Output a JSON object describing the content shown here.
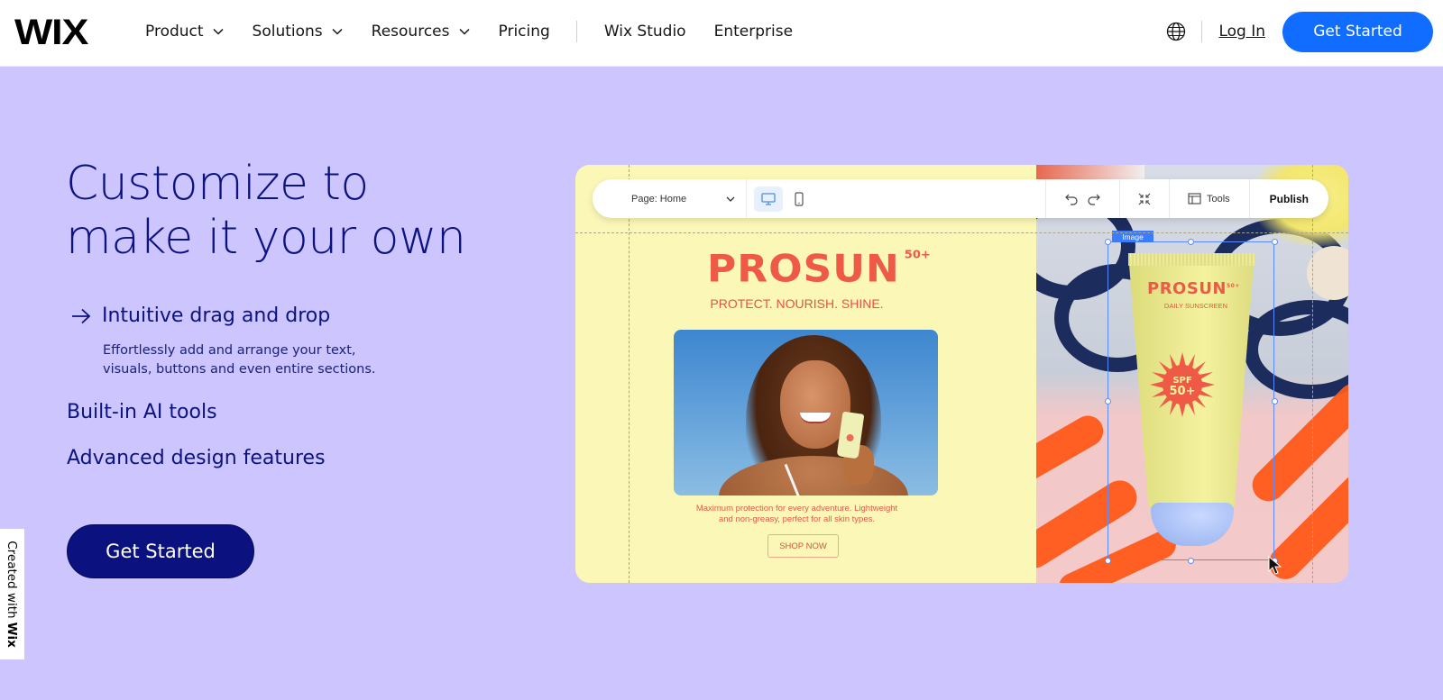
{
  "header": {
    "logo": "WIX",
    "nav": [
      {
        "label": "Product",
        "has_dropdown": true
      },
      {
        "label": "Solutions",
        "has_dropdown": true
      },
      {
        "label": "Resources",
        "has_dropdown": true
      },
      {
        "label": "Pricing",
        "has_dropdown": false
      },
      {
        "label": "Wix Studio",
        "has_dropdown": false
      },
      {
        "label": "Enterprise",
        "has_dropdown": false
      }
    ],
    "language_icon": "globe-icon",
    "login_label": "Log In",
    "cta_label": "Get Started"
  },
  "hero": {
    "title_line1": "Customize to",
    "title_line2": "make it your own",
    "features": [
      {
        "label": "Intuitive drag and drop",
        "active": true,
        "description": "Effortlessly add and arrange your text, visuals, buttons and even entire sections."
      },
      {
        "label": "Built-in AI tools",
        "active": false
      },
      {
        "label": "Advanced design features",
        "active": false
      }
    ],
    "cta_label": "Get Started"
  },
  "badge": {
    "prefix": "Created with",
    "brand": "Wix"
  },
  "editor": {
    "toolbar": {
      "page_selector": "Page: Home",
      "tools_label": "Tools",
      "publish_label": "Publish",
      "active_device": "desktop"
    },
    "site": {
      "brand": "PROSUN",
      "brand_suffix": "50+",
      "tagline": "PROTECT. NOURISH. SHINE.",
      "copy_line1": "Maximum protection for every adventure. Lightweight",
      "copy_line2": "and non-greasy, perfect for all skin types.",
      "shop_label": "SHOP NOW",
      "product_brand": "PROSUN",
      "product_brand_suffix": "50+",
      "product_sub": "DAILY SUNSCREEN",
      "spf_line1": "SPF",
      "spf_line2": "50+"
    },
    "selection_label": "Image"
  },
  "colors": {
    "background": "#cdc5fd",
    "primary_dark": "#0c1280",
    "header_cta": "#116dff",
    "brand_coral": "#ef5a47",
    "site_yellow": "#fbf7b7"
  }
}
